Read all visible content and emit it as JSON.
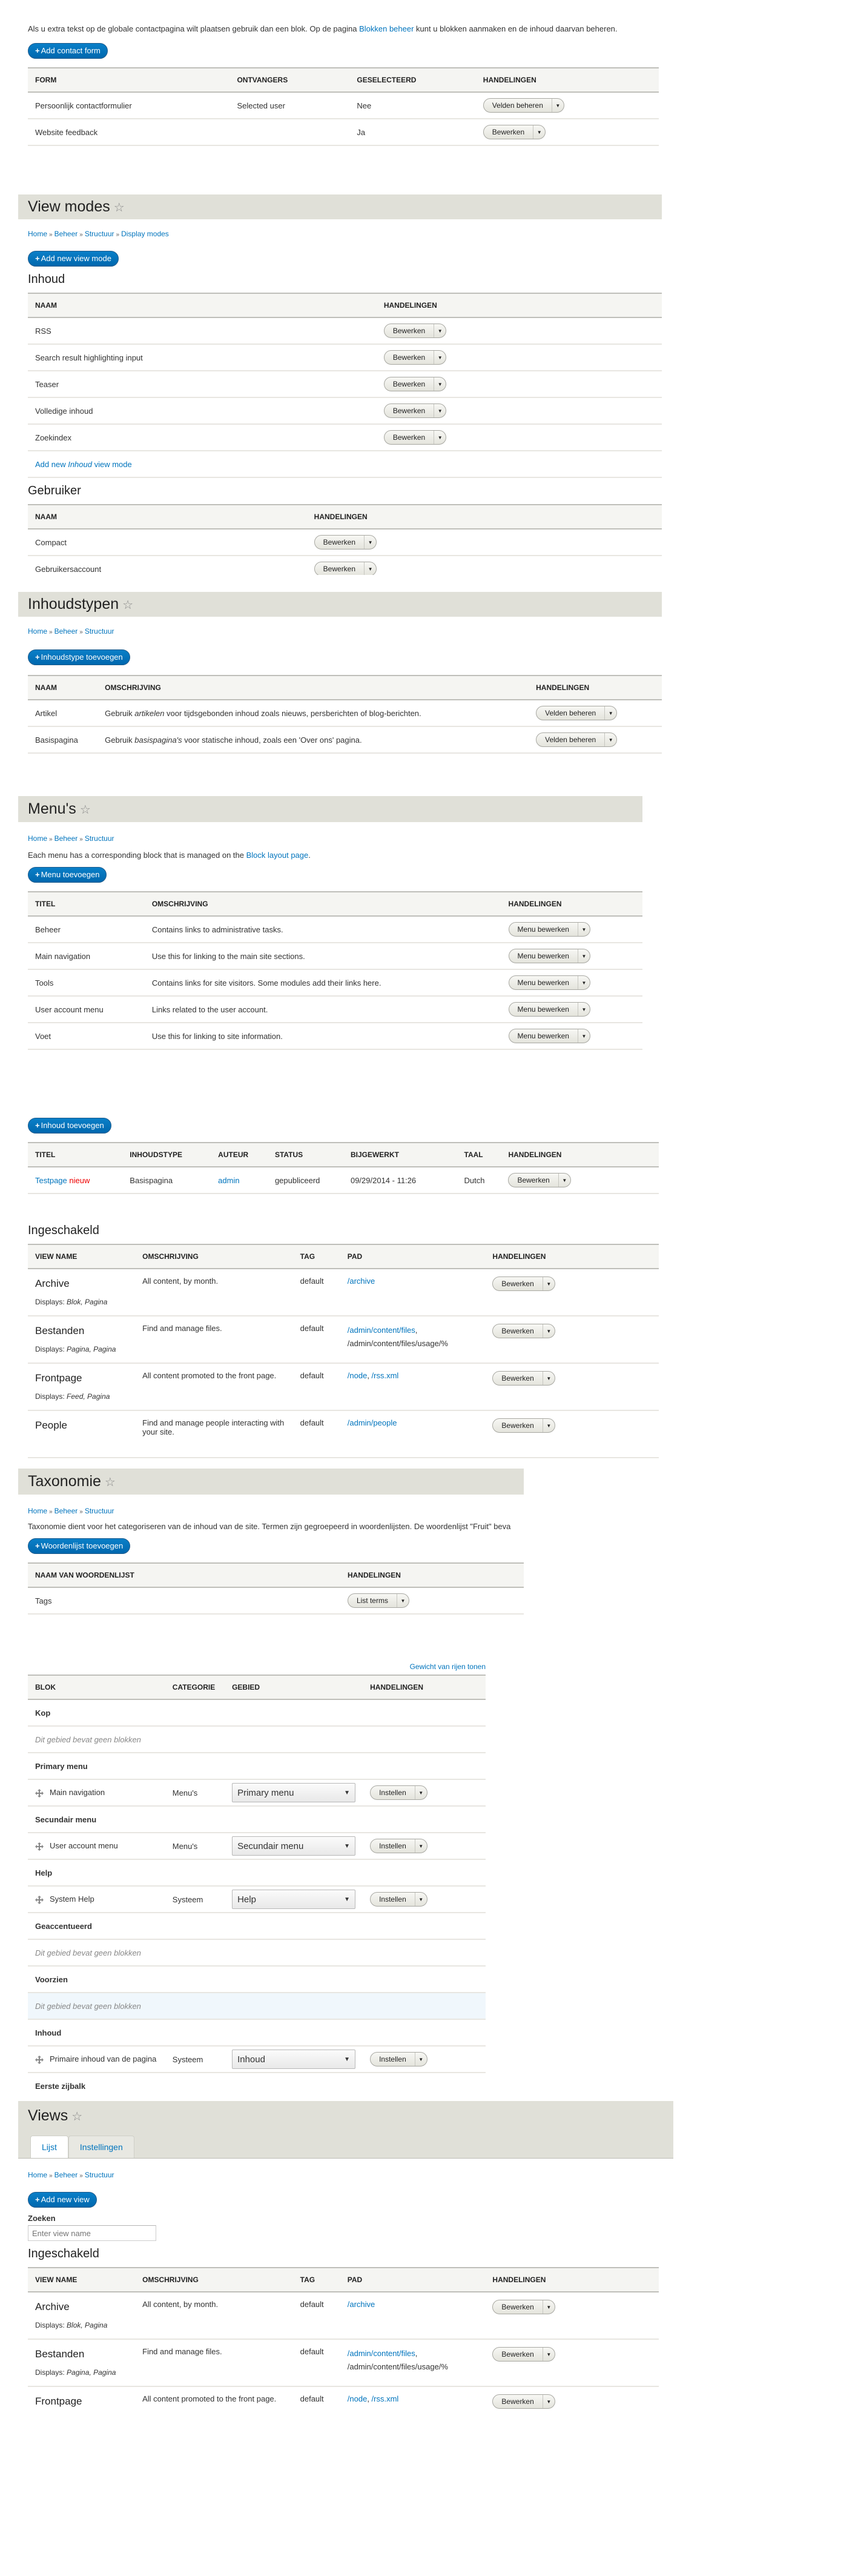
{
  "contact": {
    "intro_before": "Als u extra tekst op de globale contactpagina wilt plaatsen gebruik dan een blok. Op de pagina ",
    "intro_link": "Blokken beheer",
    "intro_after": " kunt u blokken aanmaken en de inhoud daarvan beheren.",
    "add_button": "Add contact form",
    "columns": [
      "Form",
      "Ontvangers",
      "Geselecteerd",
      "Handelingen"
    ],
    "rows": [
      {
        "form": "Persoonlijk contactformulier",
        "recipients": "Selected user",
        "selected": "Nee",
        "action": "Velden beheren"
      },
      {
        "form": "Website feedback",
        "recipients": "",
        "selected": "Ja",
        "action": "Bewerken"
      }
    ]
  },
  "view_modes": {
    "title": "View modes",
    "breadcrumb": [
      "Home",
      "Beheer",
      "Structuur",
      "Display modes"
    ],
    "add_button": "Add new view mode",
    "inhoud": {
      "heading": "Inhoud",
      "columns": [
        "Naam",
        "Handelingen"
      ],
      "rows": [
        "RSS",
        "Search result highlighting input",
        "Teaser",
        "Volledige inhoud",
        "Zoekindex"
      ],
      "action": "Bewerken",
      "add_link_before": "Add new ",
      "add_link_em": "Inhoud",
      "add_link_after": " view mode"
    },
    "gebruiker": {
      "heading": "Gebruiker",
      "columns": [
        "Naam",
        "Handelingen"
      ],
      "rows": [
        "Compact",
        "Gebruikersaccount"
      ],
      "action": "Bewerken"
    }
  },
  "content_types": {
    "title": "Inhoudstypen",
    "breadcrumb": [
      "Home",
      "Beheer",
      "Structuur"
    ],
    "add_button": "Inhoudstype toevoegen",
    "columns": [
      "Naam",
      "Omschrijving",
      "Handelingen"
    ],
    "rows": [
      {
        "name": "Artikel",
        "desc_before": "Gebruik ",
        "desc_em": "artikelen",
        "desc_after": " voor tijdsgebonden inhoud zoals nieuws, persberichten of blog-berichten.",
        "action": "Velden beheren"
      },
      {
        "name": "Basispagina",
        "desc_before": "Gebruik ",
        "desc_em": "basispagina's",
        "desc_after": " voor statische inhoud, zoals een 'Over ons' pagina.",
        "action": "Velden beheren"
      }
    ]
  },
  "menus": {
    "title": "Menu's",
    "breadcrumb": [
      "Home",
      "Beheer",
      "Structuur"
    ],
    "intro_before": "Each menu has a corresponding block that is managed on the ",
    "intro_link": "Block layout page",
    "intro_after": ".",
    "add_button": "Menu toevoegen",
    "columns": [
      "Titel",
      "Omschrijving",
      "Handelingen"
    ],
    "action": "Menu bewerken",
    "rows": [
      {
        "title": "Beheer",
        "desc": "Contains links to administrative tasks."
      },
      {
        "title": "Main navigation",
        "desc": "Use this for linking to the main site sections."
      },
      {
        "title": "Tools",
        "desc": "Contains links for site visitors. Some modules add their links here."
      },
      {
        "title": "User account menu",
        "desc": "Links related to the user account."
      },
      {
        "title": "Voet",
        "desc": "Use this for linking to site information."
      }
    ]
  },
  "content": {
    "add_button": "Inhoud toevoegen",
    "columns": [
      "Titel",
      "Inhoudstype",
      "Auteur",
      "Status",
      "Bijgewerkt",
      "Taal",
      "Handelingen"
    ],
    "row": {
      "title": "Testpage",
      "badge": "nieuw",
      "type": "Basispagina",
      "author": "admin",
      "status": "gepubliceerd",
      "updated": "09/29/2014 - 11:26",
      "language": "Dutch",
      "action": "Bewerken"
    }
  },
  "views_list": {
    "heading": "Ingeschakeld",
    "columns": [
      "View name",
      "Omschrijving",
      "Tag",
      "Pad",
      "Handelingen"
    ],
    "displays_label": "Displays:",
    "action": "Bewerken",
    "rows": [
      {
        "name": "Archive",
        "displays": "Blok, Pagina",
        "desc": "All content, by month.",
        "tag": "default",
        "path1": "/archive"
      },
      {
        "name": "Bestanden",
        "displays": "Pagina, Pagina",
        "desc": "Find and manage files.",
        "tag": "default",
        "path1": "/admin/content/files",
        "path_sep": ",",
        "path2_plain": "/admin/content/files/usage/%"
      },
      {
        "name": "Frontpage",
        "displays": "Feed, Pagina",
        "desc": "All content promoted to the front page.",
        "tag": "default",
        "path1": "/node",
        "path_sep": ", ",
        "path2": "/rss.xml"
      },
      {
        "name": "People",
        "desc": "Find and manage people interacting with your site.",
        "tag": "default",
        "path1": "/admin/people"
      }
    ]
  },
  "taxonomy": {
    "title": "Taxonomie",
    "breadcrumb": [
      "Home",
      "Beheer",
      "Structuur"
    ],
    "intro": "Taxonomie dient voor het categoriseren van de inhoud van de site. Termen zijn gegroepeerd in woordenlijsten. De woordenlijst \"Fruit\" beva",
    "add_button": "Woordenlijst toevoegen",
    "columns": [
      "Naam van woordenlijst",
      "Handelingen"
    ],
    "rows": [
      {
        "name": "Tags",
        "action": "List terms"
      }
    ]
  },
  "blocks": {
    "weight_link": "Gewicht van rijen tonen",
    "columns": [
      "Blok",
      "Categorie",
      "Gebied",
      "Handelingen"
    ],
    "empty_text": "Dit gebied bevat geen blokken",
    "action": "Instellen",
    "regions": {
      "kop": "Kop",
      "primary": "Primary menu",
      "secundair": "Secundair menu",
      "help": "Help",
      "geaccentueerd": "Geaccentueerd",
      "voorzien": "Voorzien",
      "inhoud": "Inhoud",
      "eerste_zijbalk": "Eerste zijbalk"
    },
    "items": [
      {
        "name": "Main navigation",
        "category": "Menu's",
        "region": "Primary menu"
      },
      {
        "name": "User account menu",
        "category": "Menu's",
        "region": "Secundair menu"
      },
      {
        "name": "System Help",
        "category": "Systeem",
        "region": "Help"
      },
      {
        "name": "Primaire inhoud van de pagina",
        "category": "Systeem",
        "region": "Inhoud"
      }
    ]
  },
  "views_page": {
    "title": "Views",
    "tabs": [
      "Lijst",
      "Instellingen"
    ],
    "breadcrumb": [
      "Home",
      "Beheer",
      "Structuur"
    ],
    "add_button": "Add new view",
    "search_label": "Zoeken",
    "search_placeholder": "Enter view name",
    "heading": "Ingeschakeld",
    "columns": [
      "View name",
      "Omschrijving",
      "Tag",
      "Pad",
      "Handelingen"
    ],
    "displays_label": "Displays:",
    "action": "Bewerken",
    "rows": [
      {
        "name": "Archive",
        "displays": "Blok, Pagina",
        "desc": "All content, by month.",
        "tag": "default",
        "path1": "/archive"
      },
      {
        "name": "Bestanden",
        "displays": "Pagina, Pagina",
        "desc": "Find and manage files.",
        "tag": "default",
        "path1": "/admin/content/files",
        "path_sep": ",",
        "path2_plain": "/admin/content/files/usage/%"
      },
      {
        "name": "Frontpage",
        "desc": "All content promoted to the front page.",
        "tag": "default",
        "path1": "/node",
        "path_sep": ", ",
        "path2": "/rss.xml"
      }
    ]
  },
  "colors": {
    "link": "#0074bd",
    "band": "#e0e0d8",
    "primary_button": "#0074bd",
    "new_badge": "#e00000"
  }
}
